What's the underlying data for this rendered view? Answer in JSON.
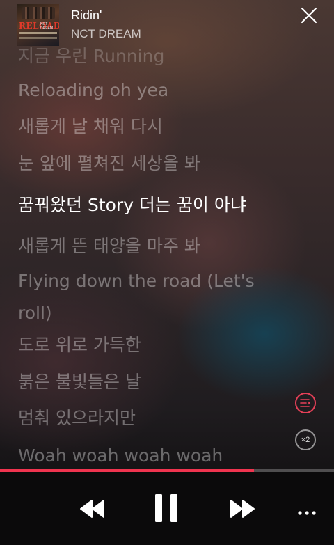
{
  "now_playing": {
    "title": "Ridin'",
    "artist": "NCT DREAM",
    "album_art": {
      "title": "RELOAD",
      "subtitle": "NCT DREAM"
    }
  },
  "lyrics": {
    "lines": [
      "지금 우린 Running",
      "Reloading oh yea",
      "새롭게 날 채워 다시",
      "눈 앞에 펼쳐진 세상을 봐",
      "꿈꿔왔던 Story 더는 꿈이 아냐",
      "새롭게 뜬 태양을 마주 봐",
      "Flying down the road (Let's roll)",
      "도로 위로 가득한",
      "붉은 불빛들은 날",
      "멈춰 있으라지만",
      "Woah woah woah woah"
    ],
    "active_index": 4
  },
  "side_controls": {
    "queue_icon": "lyrics-queue-icon",
    "speed_label": "×2"
  },
  "playback": {
    "progress_fraction": 0.76,
    "state": "playing"
  },
  "icons": {
    "close": "close-icon",
    "previous": "rewind-icon",
    "pause": "pause-icon",
    "next": "fast-forward-icon",
    "more": "more-icon"
  },
  "colors": {
    "accent": "#f0344f",
    "queue_ring": "#e64058"
  }
}
